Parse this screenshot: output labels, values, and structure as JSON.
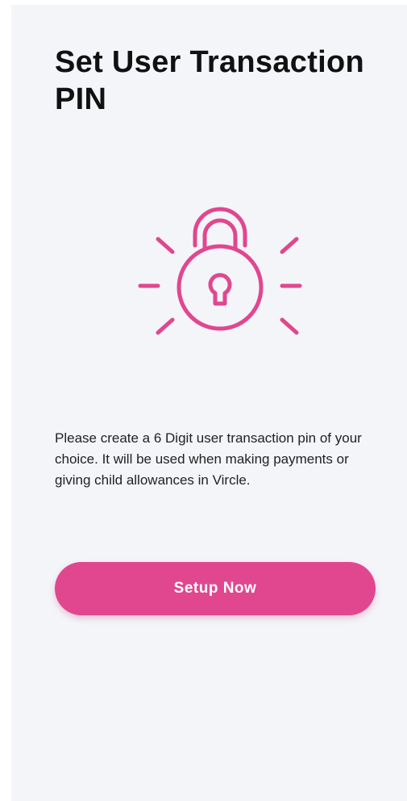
{
  "page": {
    "title": "Set User Transaction PIN",
    "description": "Please create a 6 Digit user transaction pin of your choice. It will be used when making payments or giving child allowances in Vircle."
  },
  "illustration": {
    "icon": "lock-icon",
    "color": "#e0478f"
  },
  "actions": {
    "setup_label": "Setup Now"
  },
  "colors": {
    "accent": "#e0478f",
    "background": "#f4f5f9"
  }
}
